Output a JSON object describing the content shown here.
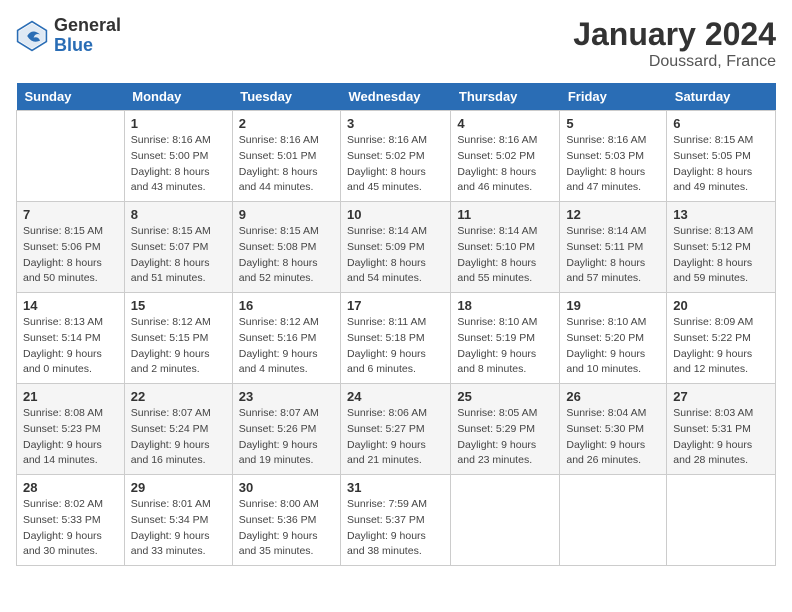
{
  "header": {
    "logo_general": "General",
    "logo_blue": "Blue",
    "month_title": "January 2024",
    "location": "Doussard, France"
  },
  "days_of_week": [
    "Sunday",
    "Monday",
    "Tuesday",
    "Wednesday",
    "Thursday",
    "Friday",
    "Saturday"
  ],
  "weeks": [
    [
      {
        "day": "",
        "sunrise": "",
        "sunset": "",
        "daylight": ""
      },
      {
        "day": "1",
        "sunrise": "Sunrise: 8:16 AM",
        "sunset": "Sunset: 5:00 PM",
        "daylight": "Daylight: 8 hours and 43 minutes."
      },
      {
        "day": "2",
        "sunrise": "Sunrise: 8:16 AM",
        "sunset": "Sunset: 5:01 PM",
        "daylight": "Daylight: 8 hours and 44 minutes."
      },
      {
        "day": "3",
        "sunrise": "Sunrise: 8:16 AM",
        "sunset": "Sunset: 5:02 PM",
        "daylight": "Daylight: 8 hours and 45 minutes."
      },
      {
        "day": "4",
        "sunrise": "Sunrise: 8:16 AM",
        "sunset": "Sunset: 5:02 PM",
        "daylight": "Daylight: 8 hours and 46 minutes."
      },
      {
        "day": "5",
        "sunrise": "Sunrise: 8:16 AM",
        "sunset": "Sunset: 5:03 PM",
        "daylight": "Daylight: 8 hours and 47 minutes."
      },
      {
        "day": "6",
        "sunrise": "Sunrise: 8:15 AM",
        "sunset": "Sunset: 5:05 PM",
        "daylight": "Daylight: 8 hours and 49 minutes."
      }
    ],
    [
      {
        "day": "7",
        "sunrise": "Sunrise: 8:15 AM",
        "sunset": "Sunset: 5:06 PM",
        "daylight": "Daylight: 8 hours and 50 minutes."
      },
      {
        "day": "8",
        "sunrise": "Sunrise: 8:15 AM",
        "sunset": "Sunset: 5:07 PM",
        "daylight": "Daylight: 8 hours and 51 minutes."
      },
      {
        "day": "9",
        "sunrise": "Sunrise: 8:15 AM",
        "sunset": "Sunset: 5:08 PM",
        "daylight": "Daylight: 8 hours and 52 minutes."
      },
      {
        "day": "10",
        "sunrise": "Sunrise: 8:14 AM",
        "sunset": "Sunset: 5:09 PM",
        "daylight": "Daylight: 8 hours and 54 minutes."
      },
      {
        "day": "11",
        "sunrise": "Sunrise: 8:14 AM",
        "sunset": "Sunset: 5:10 PM",
        "daylight": "Daylight: 8 hours and 55 minutes."
      },
      {
        "day": "12",
        "sunrise": "Sunrise: 8:14 AM",
        "sunset": "Sunset: 5:11 PM",
        "daylight": "Daylight: 8 hours and 57 minutes."
      },
      {
        "day": "13",
        "sunrise": "Sunrise: 8:13 AM",
        "sunset": "Sunset: 5:12 PM",
        "daylight": "Daylight: 8 hours and 59 minutes."
      }
    ],
    [
      {
        "day": "14",
        "sunrise": "Sunrise: 8:13 AM",
        "sunset": "Sunset: 5:14 PM",
        "daylight": "Daylight: 9 hours and 0 minutes."
      },
      {
        "day": "15",
        "sunrise": "Sunrise: 8:12 AM",
        "sunset": "Sunset: 5:15 PM",
        "daylight": "Daylight: 9 hours and 2 minutes."
      },
      {
        "day": "16",
        "sunrise": "Sunrise: 8:12 AM",
        "sunset": "Sunset: 5:16 PM",
        "daylight": "Daylight: 9 hours and 4 minutes."
      },
      {
        "day": "17",
        "sunrise": "Sunrise: 8:11 AM",
        "sunset": "Sunset: 5:18 PM",
        "daylight": "Daylight: 9 hours and 6 minutes."
      },
      {
        "day": "18",
        "sunrise": "Sunrise: 8:10 AM",
        "sunset": "Sunset: 5:19 PM",
        "daylight": "Daylight: 9 hours and 8 minutes."
      },
      {
        "day": "19",
        "sunrise": "Sunrise: 8:10 AM",
        "sunset": "Sunset: 5:20 PM",
        "daylight": "Daylight: 9 hours and 10 minutes."
      },
      {
        "day": "20",
        "sunrise": "Sunrise: 8:09 AM",
        "sunset": "Sunset: 5:22 PM",
        "daylight": "Daylight: 9 hours and 12 minutes."
      }
    ],
    [
      {
        "day": "21",
        "sunrise": "Sunrise: 8:08 AM",
        "sunset": "Sunset: 5:23 PM",
        "daylight": "Daylight: 9 hours and 14 minutes."
      },
      {
        "day": "22",
        "sunrise": "Sunrise: 8:07 AM",
        "sunset": "Sunset: 5:24 PM",
        "daylight": "Daylight: 9 hours and 16 minutes."
      },
      {
        "day": "23",
        "sunrise": "Sunrise: 8:07 AM",
        "sunset": "Sunset: 5:26 PM",
        "daylight": "Daylight: 9 hours and 19 minutes."
      },
      {
        "day": "24",
        "sunrise": "Sunrise: 8:06 AM",
        "sunset": "Sunset: 5:27 PM",
        "daylight": "Daylight: 9 hours and 21 minutes."
      },
      {
        "day": "25",
        "sunrise": "Sunrise: 8:05 AM",
        "sunset": "Sunset: 5:29 PM",
        "daylight": "Daylight: 9 hours and 23 minutes."
      },
      {
        "day": "26",
        "sunrise": "Sunrise: 8:04 AM",
        "sunset": "Sunset: 5:30 PM",
        "daylight": "Daylight: 9 hours and 26 minutes."
      },
      {
        "day": "27",
        "sunrise": "Sunrise: 8:03 AM",
        "sunset": "Sunset: 5:31 PM",
        "daylight": "Daylight: 9 hours and 28 minutes."
      }
    ],
    [
      {
        "day": "28",
        "sunrise": "Sunrise: 8:02 AM",
        "sunset": "Sunset: 5:33 PM",
        "daylight": "Daylight: 9 hours and 30 minutes."
      },
      {
        "day": "29",
        "sunrise": "Sunrise: 8:01 AM",
        "sunset": "Sunset: 5:34 PM",
        "daylight": "Daylight: 9 hours and 33 minutes."
      },
      {
        "day": "30",
        "sunrise": "Sunrise: 8:00 AM",
        "sunset": "Sunset: 5:36 PM",
        "daylight": "Daylight: 9 hours and 35 minutes."
      },
      {
        "day": "31",
        "sunrise": "Sunrise: 7:59 AM",
        "sunset": "Sunset: 5:37 PM",
        "daylight": "Daylight: 9 hours and 38 minutes."
      },
      {
        "day": "",
        "sunrise": "",
        "sunset": "",
        "daylight": ""
      },
      {
        "day": "",
        "sunrise": "",
        "sunset": "",
        "daylight": ""
      },
      {
        "day": "",
        "sunrise": "",
        "sunset": "",
        "daylight": ""
      }
    ]
  ]
}
